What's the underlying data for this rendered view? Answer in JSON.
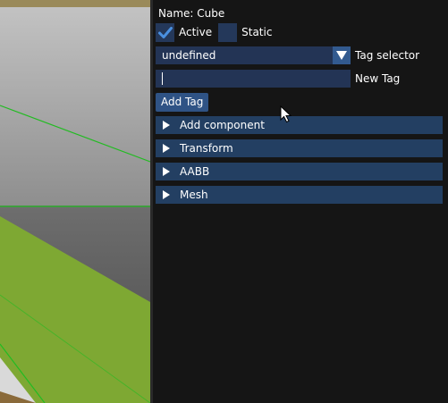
{
  "inspector": {
    "name_label": "Name: Cube",
    "active": {
      "label": "Active",
      "checked": true
    },
    "static": {
      "label": "Static",
      "checked": false
    },
    "tag_selector": {
      "value": "undefined",
      "label": "Tag selector"
    },
    "new_tag": {
      "value": "",
      "label": "New Tag"
    },
    "add_tag_label": "Add Tag",
    "components": [
      {
        "label": "Add component"
      },
      {
        "label": "Transform"
      },
      {
        "label": "AABB"
      },
      {
        "label": "Mesh"
      }
    ]
  },
  "colors": {
    "panel_bg": "#151515",
    "widget_bg": "#233455",
    "header_bg": "#233f62",
    "button_bg": "#2f5385",
    "accent": "#4a90e0",
    "ground": "#7ea833",
    "gizmo_line": "#22bb22"
  }
}
